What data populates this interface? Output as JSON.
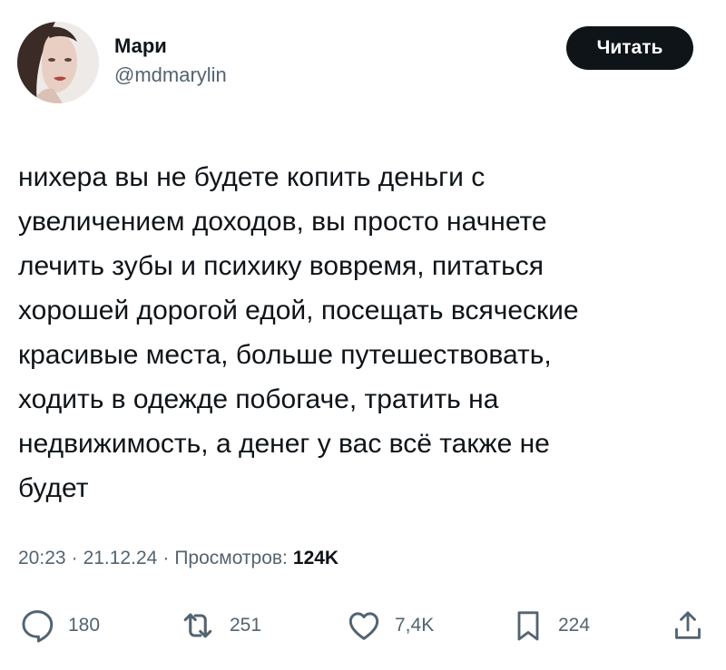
{
  "author": {
    "name": "Мари",
    "handle": "@mdmarylin"
  },
  "follow_button": {
    "label": "Читать"
  },
  "tweet": {
    "text": "нихера вы не будете копить деньги с\nувеличением доходов, вы просто начнете\nлечить зубы и психику вовремя, питаться\nхорошей дорогой едой, посещать всяческие\nкрасивые места, больше путешествовать,\nходить в одежде побогаче, тратить на\nнедвижимость, а денег у вас всё также не\nбудет"
  },
  "meta": {
    "time": "20:23",
    "date": "21.12.24",
    "separator": "·",
    "views_label": "Просмотров:",
    "views_count": "124K"
  },
  "actions": {
    "reply": {
      "icon": "reply-icon",
      "count": "180"
    },
    "retweet": {
      "icon": "retweet-icon",
      "count": "251"
    },
    "like": {
      "icon": "heart-icon",
      "count": "7,4K"
    },
    "bookmark": {
      "icon": "bookmark-icon",
      "count": "224"
    },
    "share": {
      "icon": "share-icon"
    }
  },
  "colors": {
    "text": "#0f1419",
    "secondary": "#536471",
    "button_bg": "#0f1419",
    "button_text": "#ffffff",
    "background": "#ffffff"
  }
}
